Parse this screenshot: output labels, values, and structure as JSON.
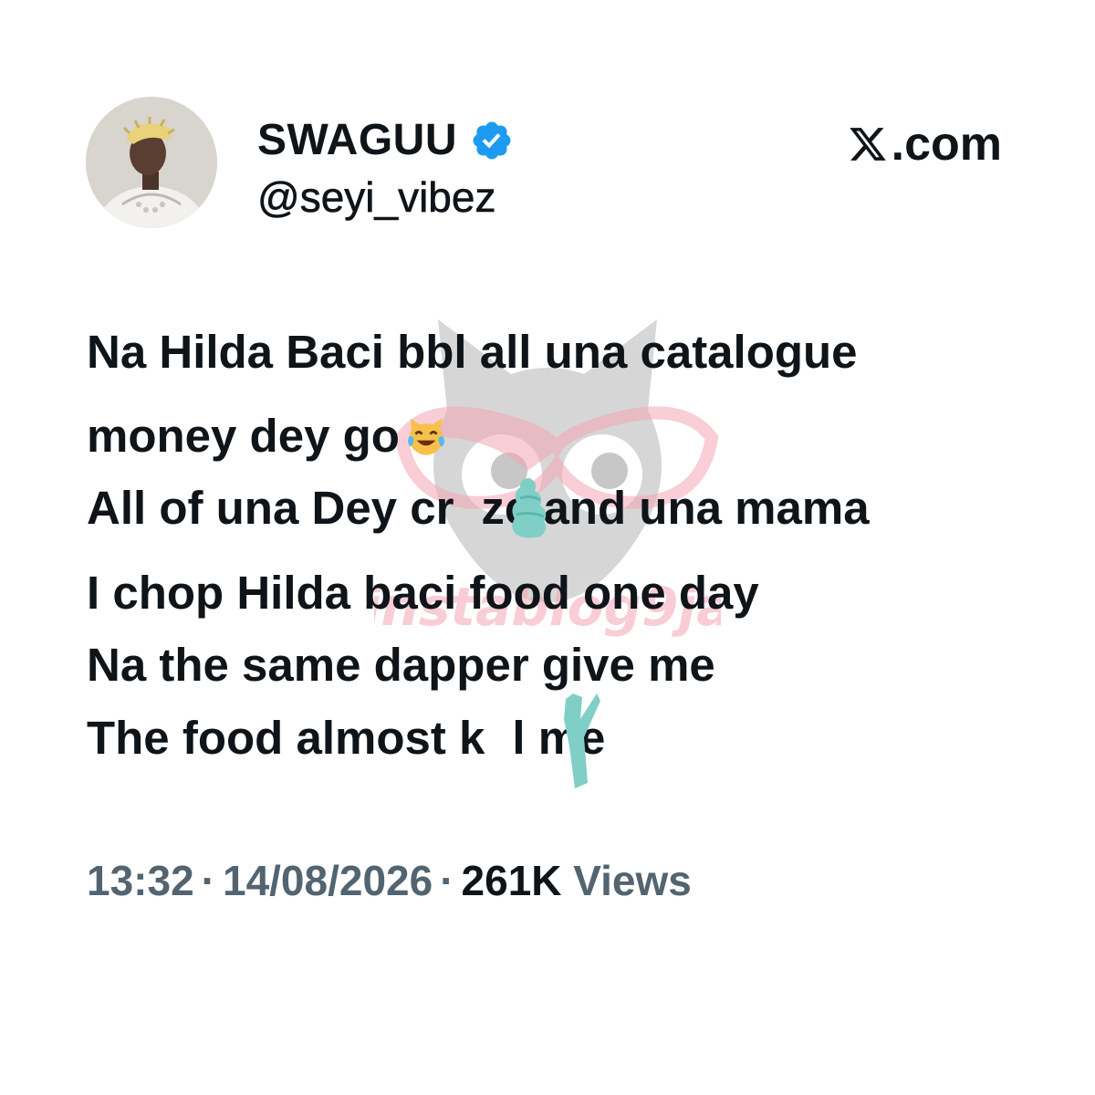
{
  "author": {
    "display_name": "SWAGUU",
    "handle": "@seyi_vibez",
    "verified": true
  },
  "source": {
    "site_label": ".com",
    "logo_icon": "x-logo-icon"
  },
  "tweet": {
    "lines": [
      "Na Hilda Baci bbl all una catalogue",
      "money dey go",
      "All of una Dey cr",
      "I chop Hilda baci food one day",
      "Na the same dapper give me",
      "The food almost k"
    ],
    "line2_tail": "ze and una mama",
    "line5_tail": "l me",
    "emoji": "cat-with-tears-of-joy-icon"
  },
  "meta": {
    "time": "13:32",
    "separator": "·",
    "date": "14/08/2026",
    "views_count": "261K",
    "views_label": "Views"
  },
  "watermark": {
    "text": "instablog9ja"
  },
  "colors": {
    "text_primary": "#0f1419",
    "text_secondary": "#536471",
    "verified_blue": "#1d9bf0",
    "scribble": "#7fcfc6",
    "watermark_pink": "#f4a6b4"
  }
}
